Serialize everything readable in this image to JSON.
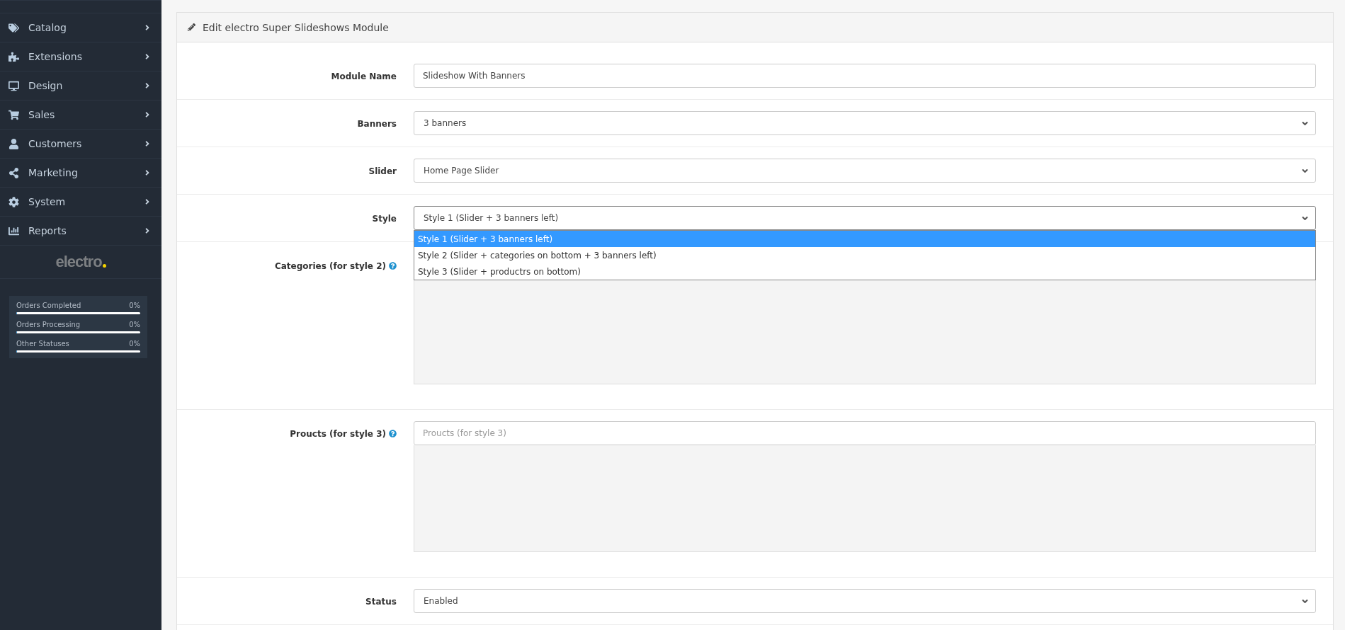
{
  "sidebar": {
    "items": [
      {
        "label": "Catalog",
        "expanded": false
      },
      {
        "label": "Extensions",
        "expanded": false
      },
      {
        "label": "Design",
        "expanded": false
      },
      {
        "label": "Sales",
        "expanded": false
      },
      {
        "label": "Customers",
        "expanded": false
      },
      {
        "label": "Marketing",
        "expanded": false
      },
      {
        "label": "System",
        "expanded": false
      },
      {
        "label": "Reports",
        "expanded": false
      }
    ],
    "logo": "electro",
    "stats": [
      {
        "label": "Orders Completed",
        "reading": "0%",
        "level": 0
      },
      {
        "label": "Orders Processing",
        "reading": "0%",
        "level": 0
      },
      {
        "label": "Other Statuses",
        "reading": "0%",
        "level": 0
      }
    ]
  },
  "panel": {
    "title": "Edit electro Super Slideshows Module",
    "fields": [
      {
        "kind": "text",
        "label": "Module Name",
        "value": "Slideshow With Banners",
        "help": false
      },
      {
        "kind": "select",
        "label": "Banners",
        "value": "3 banners",
        "expanded": false,
        "help": false
      },
      {
        "kind": "select",
        "label": "Slider",
        "value": "Home Page Slider",
        "expanded": false,
        "help": false
      },
      {
        "kind": "select",
        "label": "Style",
        "value": "Style 1 (Slider + 3 banners left)",
        "expanded": true,
        "help": false,
        "options": [
          {
            "label": "Style 1 (Slider + 3 banners left)",
            "selected": true
          },
          {
            "label": "Style 2 (Slider + categories on bottom + 3 banners left)",
            "selected": false
          },
          {
            "label": "Style 3 (Slider + productrs on bottom)",
            "selected": false
          }
        ]
      },
      {
        "kind": "autocomplete",
        "label": "Categories (for style 2)",
        "help": true
      },
      {
        "kind": "autocomplete",
        "label": "Proucts (for style 3)",
        "placeholder": "Proucts (for style 3)",
        "help": true
      },
      {
        "kind": "select",
        "label": "Status",
        "value": "Enabled",
        "expanded": false,
        "help": false
      }
    ]
  }
}
